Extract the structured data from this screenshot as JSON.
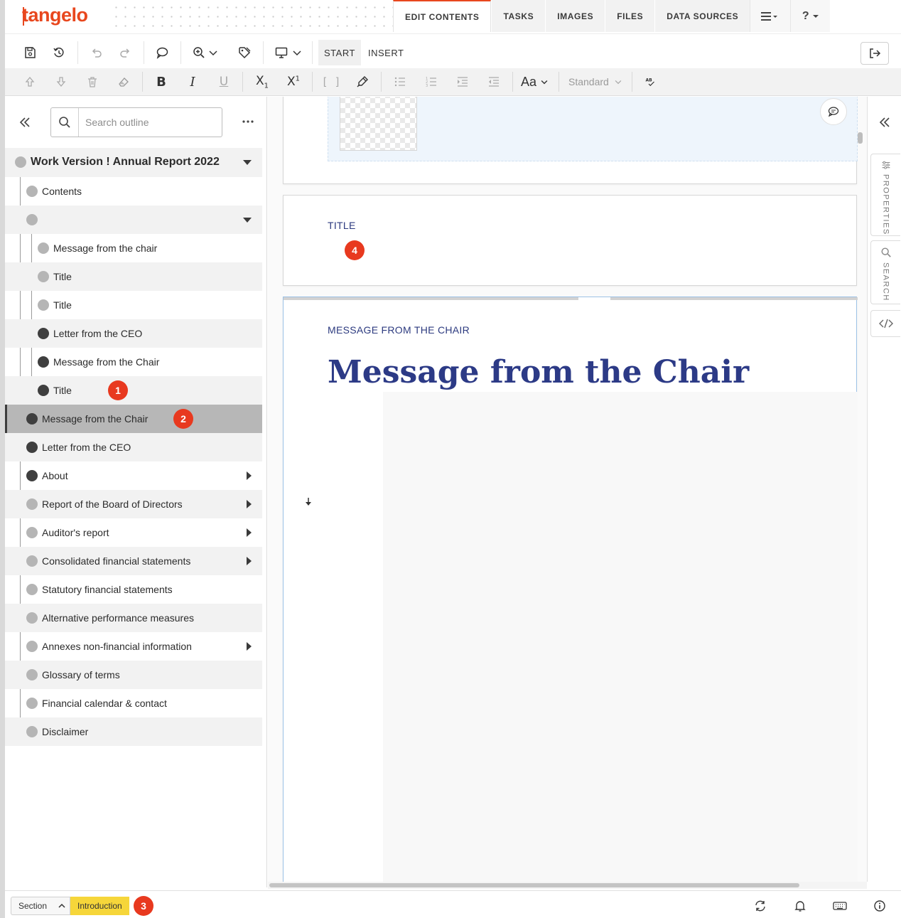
{
  "app": {
    "logo_text": "tangelo",
    "brand_color": "#e8471e"
  },
  "nav": {
    "tabs": [
      {
        "label": "EDIT CONTENTS",
        "active": true
      },
      {
        "label": "TASKS"
      },
      {
        "label": "IMAGES"
      },
      {
        "label": "FILES"
      },
      {
        "label": "DATA SOURCES"
      }
    ],
    "menu_icon": "hamburger-menu-icon",
    "help_icon": "question-mark-icon",
    "help_label": "?"
  },
  "toolbar": {
    "mode_tabs": [
      {
        "label": "START",
        "active": true
      },
      {
        "label": "INSERT"
      }
    ],
    "font_button_label": "Aa",
    "style_select_value": "Standard",
    "spellcheck_label": "AB"
  },
  "sidebar": {
    "search_placeholder": "Search outline",
    "tree": [
      {
        "label": "Work Version ! Annual Report 2022",
        "level": 0,
        "root": true,
        "expanded": true
      },
      {
        "label": "Contents",
        "level": 1,
        "dark": false
      },
      {
        "label": "",
        "level": 1,
        "dark": false,
        "expanded": true
      },
      {
        "label": "Message from the chair",
        "level": 2,
        "dark": false
      },
      {
        "label": "Title",
        "level": 2,
        "dark": false
      },
      {
        "label": "Title",
        "level": 2,
        "dark": false
      },
      {
        "label": "Letter from the CEO",
        "level": 2,
        "dark": true
      },
      {
        "label": "Message from the Chair",
        "level": 2,
        "dark": true
      },
      {
        "label": "Title",
        "level": 2,
        "dark": true,
        "badge": "1"
      },
      {
        "label": "Message from the Chair",
        "level": 1,
        "dark": true,
        "selected": true,
        "badge": "2"
      },
      {
        "label": "Letter from the CEO",
        "level": 1,
        "dark": true
      },
      {
        "label": "About",
        "level": 1,
        "dark": true,
        "collapsed": true
      },
      {
        "label": "Report of the Board of Directors",
        "level": 1,
        "dark": false,
        "collapsed": true
      },
      {
        "label": "Auditor's report",
        "level": 1,
        "dark": false,
        "collapsed": true
      },
      {
        "label": "Consolidated financial statements",
        "level": 1,
        "dark": false,
        "collapsed": true
      },
      {
        "label": "Statutory financial statements",
        "level": 1,
        "dark": false
      },
      {
        "label": "Alternative performance measures",
        "level": 1,
        "dark": false
      },
      {
        "label": "Annexes non-financial information",
        "level": 1,
        "dark": false,
        "collapsed": true
      },
      {
        "label": "Glossary of terms",
        "level": 1,
        "dark": false
      },
      {
        "label": "Financial calendar & contact",
        "level": 1,
        "dark": false
      },
      {
        "label": "Disclaimer",
        "level": 1,
        "dark": false
      }
    ]
  },
  "content": {
    "card2_label": "TITLE",
    "card2_badge": "4",
    "card3_label": "MESSAGE FROM THE CHAIR",
    "card3_title": "Message from the Chair"
  },
  "rail": {
    "properties_label": "PROPERTIES",
    "search_label": "SEARCH"
  },
  "statusbar": {
    "section_label": "Section",
    "crumb_label": "Introduction",
    "badge": "3",
    "crumb_color": "#f6d63a"
  },
  "colors": {
    "badge": "#e8391f",
    "heading": "#2c3a86"
  }
}
